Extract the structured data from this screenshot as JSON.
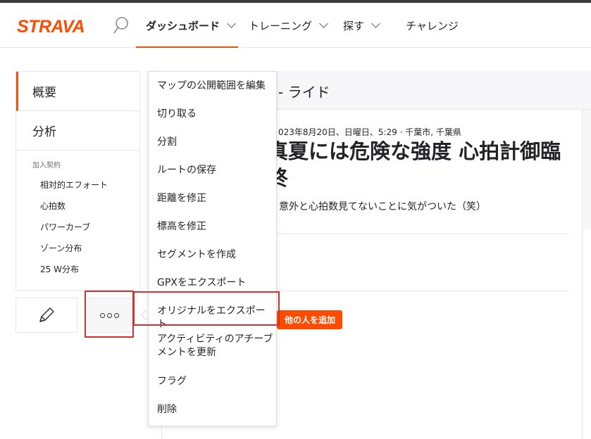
{
  "app": {
    "logo": "STRAVA"
  },
  "colors": {
    "brand": "#fc4c02",
    "highlight": "#d62d2d"
  },
  "nav": {
    "search_icon": "search-icon",
    "items": [
      {
        "label": "ダッシュボード",
        "active": true
      },
      {
        "label": "トレーニング"
      },
      {
        "label": "探す"
      },
      {
        "label": "チャレンジ"
      }
    ]
  },
  "sidebar": {
    "tabs": [
      {
        "label": "概要",
        "active": true
      },
      {
        "label": "分析"
      }
    ],
    "subscription_heading": "加入契約",
    "sub_items": [
      "相対的エフォート",
      "心拍数",
      "パワーカーブ",
      "ゾーン分布",
      "25 W分布"
    ],
    "edit_icon": "pencil-icon",
    "more_icon": "more-options-icon"
  },
  "activity": {
    "header_title": "- ライド",
    "date": "023年8月20日、日曜日、5:29 · 千葉市, 千葉県",
    "title": "真夏には危険な強度 心拍計御臨終",
    "description": "意外と心拍数見てないことに気がついた（笑）",
    "add_others_label": "他の人を追加"
  },
  "menu": {
    "items": [
      "マップの公開範囲を編集",
      "切り取る",
      "分割",
      "ルートの保存",
      "距離を修正",
      "標高を修正",
      "セグメントを作成",
      "GPXをエクスポート",
      "オリジナルをエクスポート",
      "アクティビティのアチーブメントを更新",
      "フラグ",
      "削除"
    ]
  }
}
